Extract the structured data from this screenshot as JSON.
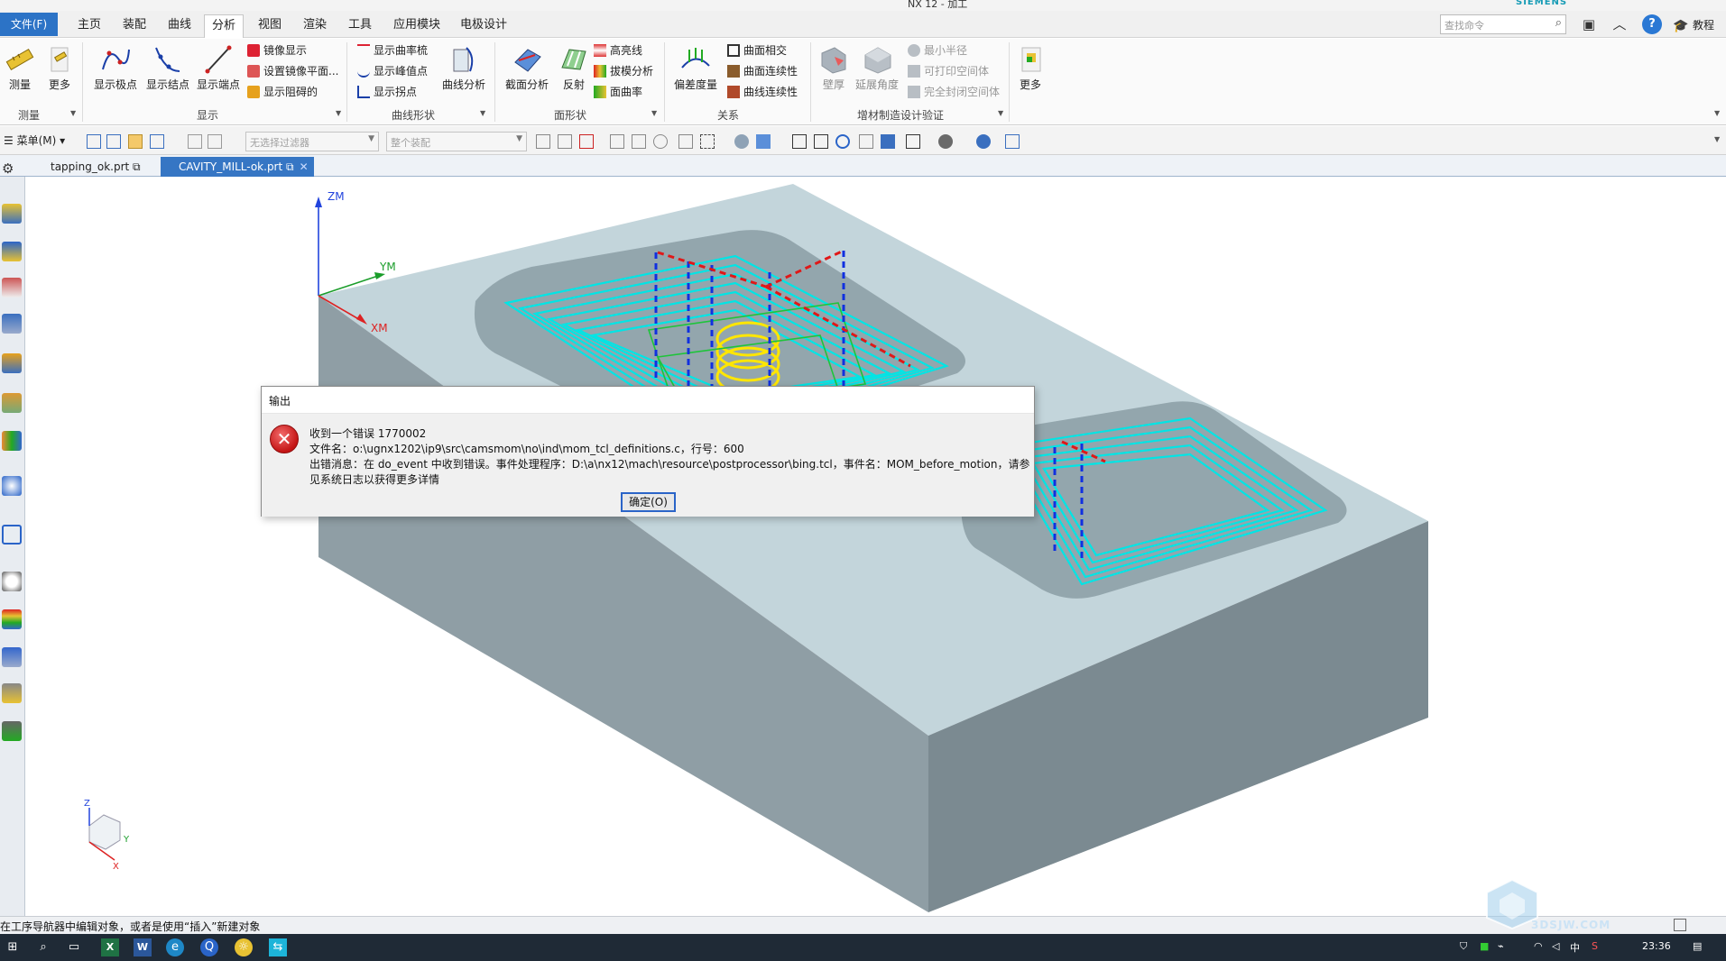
{
  "window": {
    "title": "NX 12 - 加工",
    "brand": "SIEMENS"
  },
  "ribbon_tabs": {
    "file": "文件(F)",
    "items": [
      "主页",
      "装配",
      "曲线",
      "分析",
      "视图",
      "渲染",
      "工具",
      "应用模块",
      "电极设计"
    ],
    "active": "分析"
  },
  "search": {
    "placeholder": "查找命令"
  },
  "help": {
    "teach_label": "教程"
  },
  "ribbon": {
    "measure": {
      "group": "测量",
      "measure_label": "测量",
      "more_label": "更多"
    },
    "display": {
      "group": "显示",
      "show_poles": "显示极点",
      "show_knots": "显示结点",
      "show_endpoints": "显示端点",
      "mirror_display": "镜像显示",
      "set_mirror_plane": "设置镜像平面...",
      "show_block": "显示阻碍的"
    },
    "curve_shape": {
      "group": "曲线形状",
      "show_curvature_comb": "显示曲率梳",
      "show_peak": "显示峰值点",
      "show_inflection": "显示拐点",
      "curve_analysis": "曲线分析"
    },
    "face_shape": {
      "group": "面形状",
      "section_analysis": "截面分析",
      "reflection": "反射",
      "highlight_lines": "高亮线",
      "draft_analysis": "拔模分析",
      "face_curvature": "面曲率"
    },
    "relation": {
      "group": "关系",
      "deviation": "偏差度量",
      "face_intersect": "曲面相交",
      "face_continuity": "曲面连续性",
      "curve_continuity": "曲线连续性"
    },
    "additive": {
      "group": "增材制造设计验证",
      "wall_thickness": "壁厚",
      "overhang_angle": "延展角度",
      "min_radius": "最小半径",
      "printable_void": "可打印空间体",
      "closed_void": "完全封闭空间体"
    },
    "more": {
      "label": "更多"
    }
  },
  "cmdbar": {
    "menu_label": "菜单(M)",
    "filter_placeholder": "无选择过滤器",
    "scope_placeholder": "整个装配"
  },
  "doc_tabs": [
    {
      "name": "tapping_ok.prt",
      "active": false
    },
    {
      "name": "CAVITY_MILL-ok.prt",
      "active": true
    }
  ],
  "viewport": {
    "axis_z": "ZM",
    "axis_y": "YM",
    "axis_x": "XM",
    "triad_z": "Z",
    "triad_x": "X",
    "triad_y": "Y"
  },
  "dialog": {
    "title": "输出",
    "line1": "收到一个错误 1770002",
    "line2": "文件名：o:\\ugnx1202\\ip9\\src\\camsmom\\no\\ind\\mom_tcl_definitions.c，行号：600",
    "line3": "出错消息：在 do_event 中收到错误。事件处理程序：D:\\a\\nx12\\mach\\resource\\postprocessor\\bing.tcl，事件名：MOM_before_motion，请参",
    "line4": "见系统日志以获得更多详情",
    "ok_label": "确定(O)"
  },
  "status": {
    "text": "在工序导航器中编辑对象，或者是使用“插入”新建对象"
  },
  "taskbar": {
    "time": "23:36",
    "ime": "中",
    "watermark": "3DSJW.COM"
  },
  "colors": {
    "accent": "#2c73c6",
    "toolpath_cyan": "#00e5e5",
    "toolpath_red": "#e01818",
    "toolpath_blue": "#1030e0",
    "toolpath_yellow": "#ffe600",
    "part_top": "#c5d6dc",
    "part_side": "#7f8e95"
  }
}
